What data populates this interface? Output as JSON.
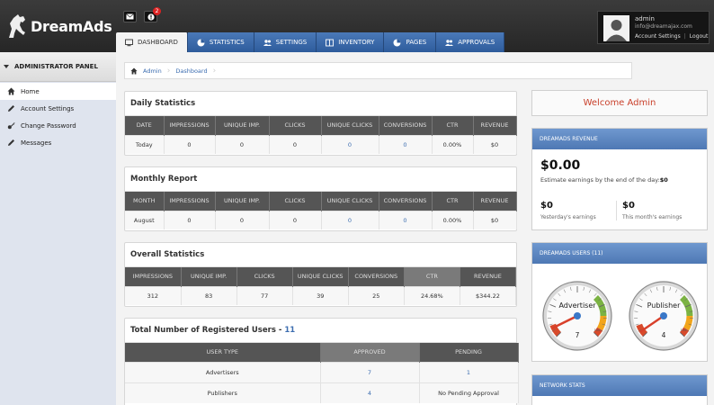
{
  "app": {
    "logo_text": "DreamAds"
  },
  "topbar": {
    "notification_count": "2",
    "tabs": [
      {
        "label": "Dashboard",
        "icon": "monitor-icon"
      },
      {
        "label": "Statistics",
        "icon": "pie-chart-icon"
      },
      {
        "label": "Settings",
        "icon": "users-icon"
      },
      {
        "label": "Inventory",
        "icon": "columns-icon"
      },
      {
        "label": "Pages",
        "icon": "pie-chart-icon"
      },
      {
        "label": "Approvals",
        "icon": "users-icon"
      }
    ],
    "user": {
      "name": "admin",
      "email": "info@dreamajax.com",
      "account_settings": "Account Settings",
      "logout": "Logout"
    }
  },
  "sidebar": {
    "heading": "ADMINISTRATOR PANEL",
    "items": [
      {
        "label": "Home"
      },
      {
        "label": "Account Settings"
      },
      {
        "label": "Change Password"
      },
      {
        "label": "Messages"
      }
    ]
  },
  "breadcrumb": [
    "Admin",
    "Dashboard"
  ],
  "daily": {
    "title": "Daily Statistics",
    "headers": [
      "DATE",
      "IMPRESSIONS",
      "UNIQUE IMP.",
      "CLICKS",
      "UNIQUE CLICKS",
      "CONVERSIONS",
      "CTR",
      "REVENUE"
    ],
    "row": [
      "Today",
      "0",
      "0",
      "0",
      "0",
      "0",
      "0.00%",
      "$0"
    ]
  },
  "monthly": {
    "title": "Monthly Report",
    "headers": [
      "MONTH",
      "IMPRESSIONS",
      "UNIQUE IMP.",
      "CLICKS",
      "UNIQUE CLICKS",
      "CONVERSIONS",
      "CTR",
      "REVENUE"
    ],
    "row": [
      "August",
      "0",
      "0",
      "0",
      "0",
      "0",
      "0.00%",
      "$0"
    ]
  },
  "overall": {
    "title": "Overall Statistics",
    "headers": [
      "IMPRESSIONS",
      "UNIQUE IMP.",
      "CLICKS",
      "UNIQUE CLICKS",
      "CONVERSIONS",
      "CTR",
      "REVENUE"
    ],
    "row": [
      "312",
      "83",
      "77",
      "39",
      "25",
      "24.68%",
      "$344.22"
    ]
  },
  "registered": {
    "title": "Total Number of Registered Users -",
    "count": "11",
    "headers": [
      "USER TYPE",
      "APPROVED",
      "PENDING"
    ],
    "rows": [
      [
        "Advertisers",
        "7",
        "1"
      ],
      [
        "Publishers",
        "4",
        "No Pending Approval"
      ]
    ]
  },
  "welcome": "Welcome Admin",
  "revenue": {
    "heading": "DREAMADS REVENUE",
    "amount": "$0.00",
    "estimate_label": "Estimate earnings by the end of the day:",
    "estimate_value": "$0",
    "yesterday_value": "$0",
    "yesterday_label": "Yesterday's earnings",
    "month_value": "$0",
    "month_label": "This month's earnings"
  },
  "users_panel": {
    "heading": "DREAMADS USERS (11)",
    "gauges": [
      {
        "label": "Advertiser",
        "value": "7",
        "max_label": "100",
        "fraction": 0.07
      },
      {
        "label": "Publisher",
        "value": "4",
        "max_label": "100",
        "fraction": 0.04
      }
    ]
  },
  "network": {
    "heading": "NETWORK STATS"
  },
  "colors": {
    "tab_blue": "#3c6db0",
    "welcome_red": "#c9402b",
    "header_gray": "#555555"
  }
}
